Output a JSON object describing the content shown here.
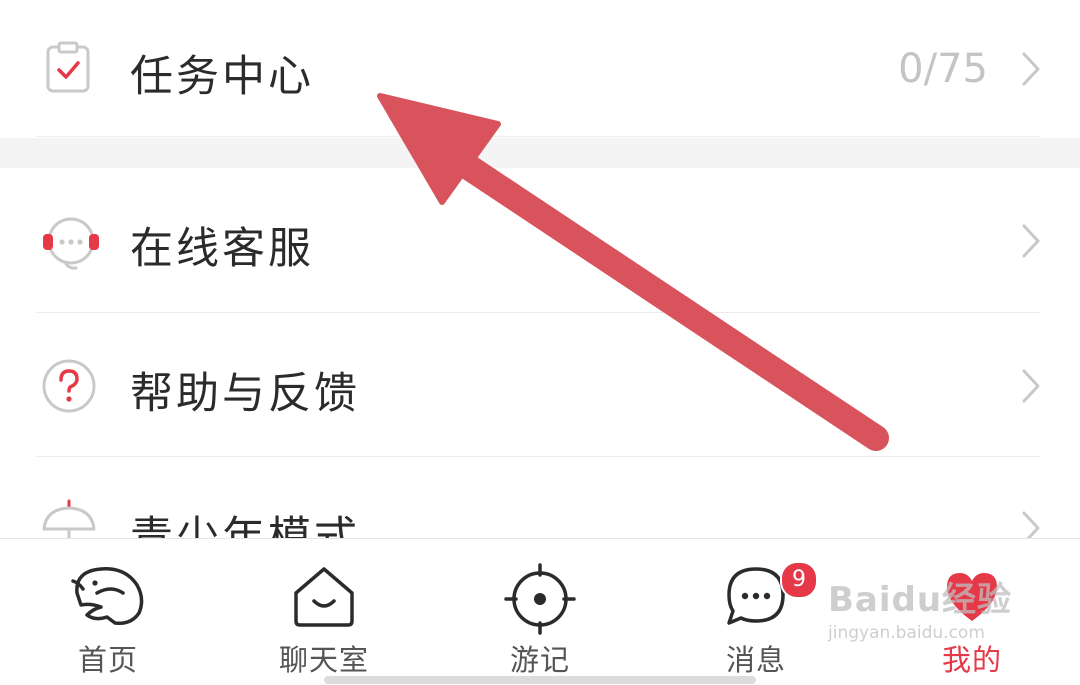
{
  "menu": {
    "task_center": {
      "label": "任务中心",
      "count": "0/75",
      "icon": "clipboard-check-icon"
    },
    "customer_service": {
      "label": "在线客服",
      "icon": "headset-icon"
    },
    "help_feedback": {
      "label": "帮助与反馈",
      "icon": "question-circle-icon"
    },
    "teen_mode": {
      "label": "青少年模式",
      "icon": "umbrella-icon"
    }
  },
  "tabbar": {
    "tabs": [
      {
        "label": "首页",
        "icon": "dolphin-icon",
        "active": false
      },
      {
        "label": "聊天室",
        "icon": "house-smile-icon",
        "active": false
      },
      {
        "label": "游记",
        "icon": "crosshair-icon",
        "active": false
      },
      {
        "label": "消息",
        "icon": "chat-bubble-icon",
        "active": false,
        "badge": "9"
      },
      {
        "label": "我的",
        "icon": "heart-icon",
        "active": true
      }
    ]
  },
  "watermark": {
    "main": "Baidu经验",
    "sub": "jingyan.baidu.com"
  },
  "colors": {
    "accent": "#e53948",
    "arrow": "#d9535d",
    "text": "#2b2b2b",
    "muted": "#c4c4c4"
  }
}
